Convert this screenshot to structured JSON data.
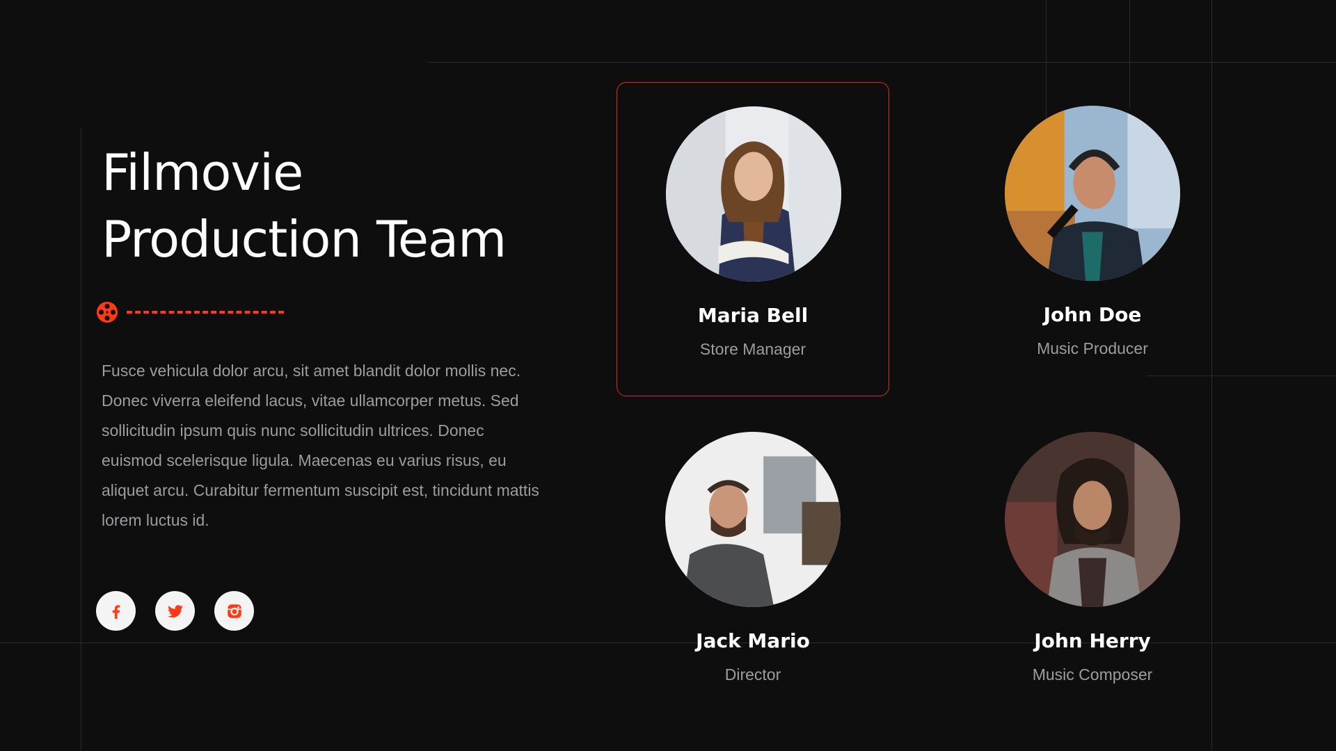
{
  "heading": {
    "line1": "Filmovie",
    "line2": "Production Team"
  },
  "description": "Fusce vehicula dolor arcu, sit amet blandit dolor mollis nec. Donec viverra eleifend lacus, vitae ullamcorper metus. Sed sollicitudin ipsum quis nunc sollicitudin ultrices. Donec euismod scelerisque ligula. Maecenas eu varius risus, eu aliquet arcu. Curabitur fermentum suscipit est, tincidunt mattis lorem luctus id.",
  "socials": [
    {
      "icon": "facebook-icon"
    },
    {
      "icon": "twitter-icon"
    },
    {
      "icon": "instagram-icon"
    }
  ],
  "team": [
    {
      "name": "Maria Bell",
      "role": "Store Manager",
      "selected": true
    },
    {
      "name": "John Doe",
      "role": "Music Producer",
      "selected": false
    },
    {
      "name": "Jack Mario",
      "role": "Director",
      "selected": false
    },
    {
      "name": "John Herry",
      "role": "Music Composer",
      "selected": false
    }
  ],
  "colors": {
    "background": "#0e0e0f",
    "accent": "#ff3a17",
    "muted_text": "#9d9da1"
  }
}
